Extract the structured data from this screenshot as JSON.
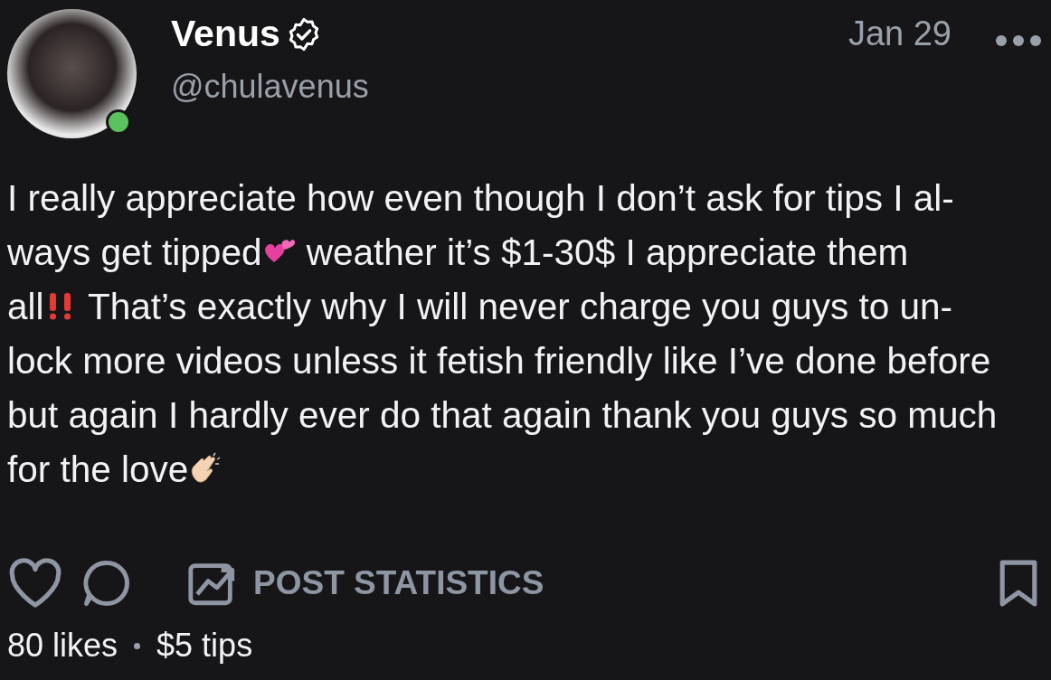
{
  "post": {
    "author": {
      "name": "Venus",
      "verified": true,
      "handle": "@chulavenus",
      "online": true
    },
    "date": "Jan 29",
    "body": [
      [
        {
          "kind": "text",
          "text": "I really appreciate how even though I don’t ask for tips I al-"
        }
      ],
      [
        {
          "kind": "text",
          "text": "ways get tipped"
        },
        {
          "kind": "hearts"
        },
        {
          "kind": "text",
          "text": " weather it’s $1-30$ I appreciate them"
        }
      ],
      [
        {
          "kind": "text",
          "text": "all"
        },
        {
          "kind": "bangs"
        },
        {
          "kind": "text",
          "text": " That’s exactly why I will never charge you guys to un-"
        }
      ],
      [
        {
          "kind": "text",
          "text": "lock more videos unless it fetish friendly like I’ve done before"
        }
      ],
      [
        {
          "kind": "text",
          "text": "but again I hardly ever do that again thank you guys so much"
        }
      ],
      [
        {
          "kind": "text",
          "text": "for the love"
        },
        {
          "kind": "clap"
        }
      ]
    ],
    "actions": {
      "liked": false,
      "bookmarked": false,
      "statistics_label": "POST STATISTICS"
    },
    "likes": "80 likes",
    "tips": "$5 tips"
  }
}
